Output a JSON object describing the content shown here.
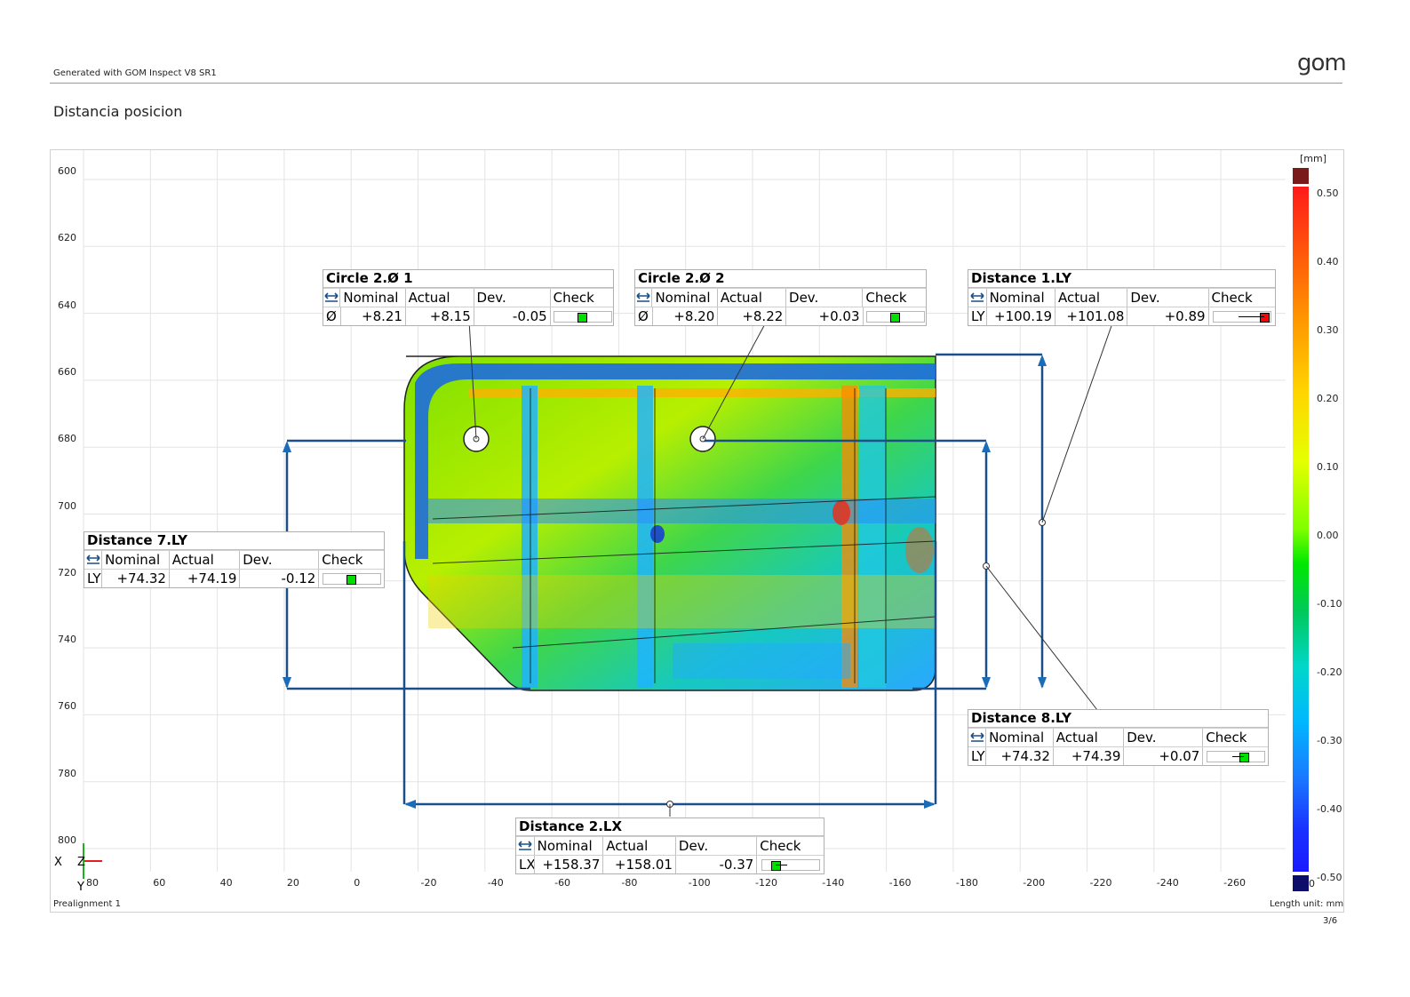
{
  "header": {
    "generated_text": "Generated with GOM Inspect V8 SR1",
    "logo_text": "gom",
    "page_title": "Distancia posicion"
  },
  "axes": {
    "y_ticks": [
      "600",
      "620",
      "640",
      "660",
      "680",
      "700",
      "720",
      "740",
      "760",
      "780",
      "800"
    ],
    "x_ticks": [
      "80",
      "60",
      "40",
      "20",
      "0",
      "-20",
      "-40",
      "-60",
      "-80",
      "-100",
      "-120",
      "-140",
      "-160",
      "-180",
      "-200",
      "-220",
      "-240",
      "-260"
    ],
    "coord_labels": {
      "x": "X",
      "z": "Z",
      "y": "Y"
    }
  },
  "colorbar": {
    "unit": "[mm]",
    "ticks": [
      "0.50",
      "0.40",
      "0.30",
      "0.20",
      "0.10",
      "0.00",
      "-0.10",
      "-0.20",
      "-0.30",
      "-0.40",
      "-0.50"
    ],
    "bottom_tick": "0"
  },
  "labels": [
    {
      "title": "Circle 2.Ø 1",
      "headers": [
        "Nominal",
        "Actual",
        "Dev.",
        "Check"
      ],
      "type": "Ø",
      "nominal": "+8.21",
      "actual": "+8.15",
      "dev": "-0.05",
      "check_color": "#00e000",
      "check_position": 0.5,
      "check_bar": false
    },
    {
      "title": "Circle 2.Ø 2",
      "headers": [
        "Nominal",
        "Actual",
        "Dev.",
        "Check"
      ],
      "type": "Ø",
      "nominal": "+8.20",
      "actual": "+8.22",
      "dev": "+0.03",
      "check_color": "#00e000",
      "check_position": 0.5,
      "check_bar": false
    },
    {
      "title": "Distance 1.LY",
      "headers": [
        "Nominal",
        "Actual",
        "Dev.",
        "Check"
      ],
      "type": "LY",
      "nominal": "+100.19",
      "actual": "+101.08",
      "dev": "+0.89",
      "check_color": "#ff0000",
      "check_position": 1.0,
      "check_bar": true
    },
    {
      "title": "Distance 7.LY",
      "headers": [
        "Nominal",
        "Actual",
        "Dev.",
        "Check"
      ],
      "type": "LY",
      "nominal": "+74.32",
      "actual": "+74.19",
      "dev": "-0.12",
      "check_color": "#00e000",
      "check_position": 0.5,
      "check_bar": false
    },
    {
      "title": "Distance 8.LY",
      "headers": [
        "Nominal",
        "Actual",
        "Dev.",
        "Check"
      ],
      "type": "LY",
      "nominal": "+74.32",
      "actual": "+74.39",
      "dev": "+0.07",
      "check_color": "#00e000",
      "check_position": 0.7,
      "check_bar": true
    },
    {
      "title": "Distance 2.LX",
      "headers": [
        "Nominal",
        "Actual",
        "Dev.",
        "Check"
      ],
      "type": "LX",
      "nominal": "+158.37",
      "actual": "+158.01",
      "dev": "-0.37",
      "check_color": "#00e000",
      "check_position": 0.2,
      "check_bar": true
    }
  ],
  "footer": {
    "alignment": "Prealignment 1",
    "length_unit": "Length unit: mm",
    "page": "3/6"
  }
}
